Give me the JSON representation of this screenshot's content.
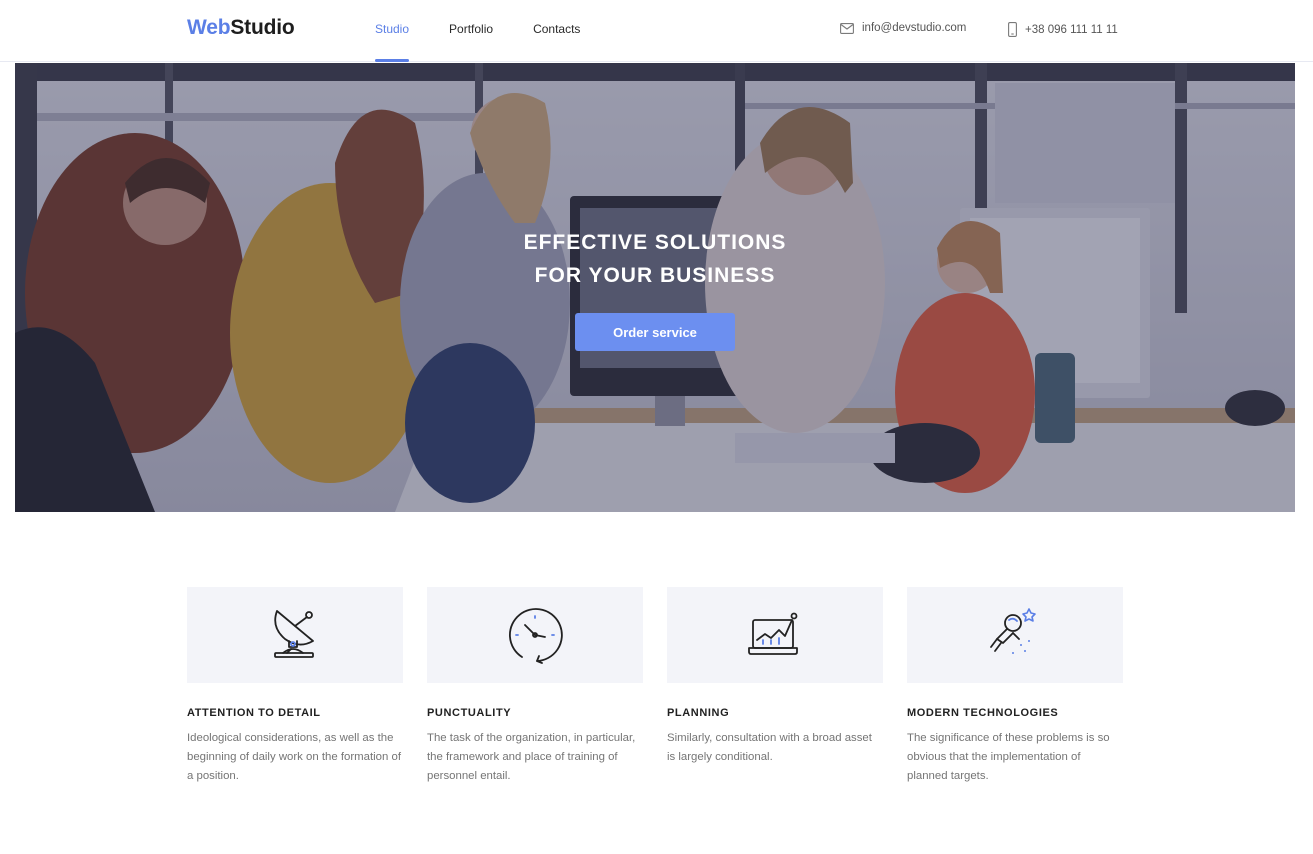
{
  "header": {
    "logo_accent": "Web",
    "logo_rest": "Studio",
    "nav": [
      {
        "label": "Studio",
        "active": true
      },
      {
        "label": "Portfolio",
        "active": false
      },
      {
        "label": "Contacts",
        "active": false
      }
    ],
    "email": "info@devstudio.com",
    "phone": "+38 096 111 11 11"
  },
  "hero": {
    "title_line1": "EFFECTIVE SOLUTIONS",
    "title_line2": "FOR YOUR BUSINESS",
    "button_label": "Order service"
  },
  "features": [
    {
      "icon": "satellite-dish-icon",
      "title": "ATTENTION TO DETAIL",
      "text": "Ideological considerations, as well as the beginning of daily work on the formation of a position."
    },
    {
      "icon": "clock-icon",
      "title": "PUNCTUALITY",
      "text": "The task of the organization, in particular, the framework and place of training of personnel entail."
    },
    {
      "icon": "laptop-chart-icon",
      "title": "PLANNING",
      "text": "Similarly, consultation with a broad asset is largely conditional."
    },
    {
      "icon": "astronaut-icon",
      "title": "MODERN TECHNOLOGIES",
      "text": "The significance of these problems is so obvious that the implementation of planned targets."
    }
  ],
  "colors": {
    "accent": "#5b7fe6",
    "button": "#6c8ff0",
    "feature_bg": "#f3f4f9",
    "heading": "#212121",
    "body_text": "#757575"
  }
}
